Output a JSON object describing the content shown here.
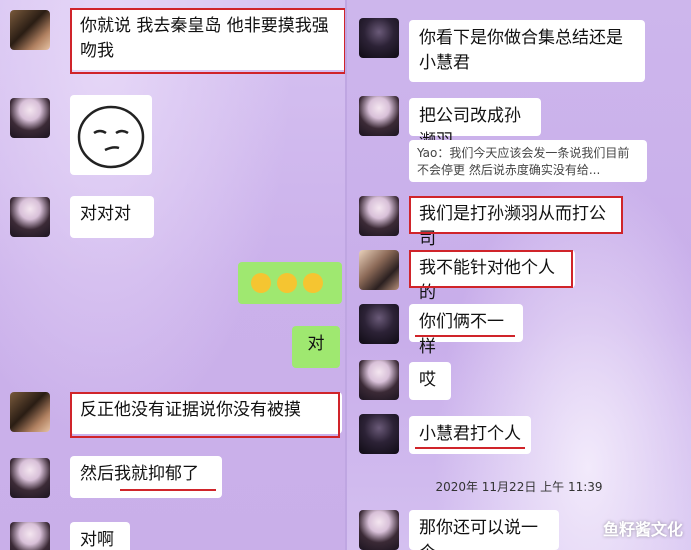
{
  "left": {
    "messages": [
      {
        "text": "你就说 我去秦皇岛 他非要摸我强吻我"
      },
      {
        "text": "对对对"
      },
      {
        "text": "对"
      },
      {
        "text": "反正他没有证据说你没有被摸"
      },
      {
        "text": "然后我就抑郁了"
      },
      {
        "text": "对啊"
      }
    ]
  },
  "right": {
    "messages": [
      {
        "text": "你看下是你做合集总结还是小慧君"
      },
      {
        "text": "把公司改成孙濒羽"
      },
      {
        "text": "Yao：我们今天应该会发一条说我们目前不会停更 然后说赤度确实没有给..."
      },
      {
        "text": "我们是打孙濒羽从而打公司"
      },
      {
        "text": "我不能针对他个人的"
      },
      {
        "text": "你们俩不一样"
      },
      {
        "text": "哎"
      },
      {
        "text": "小慧君打个人"
      },
      {
        "text": "那你还可以说一个"
      }
    ],
    "timestamp": "2020年 11月22日 上午 11:39"
  },
  "watermark": "鱼籽酱文化",
  "colors": {
    "highlight": "#d0242a",
    "sent_bubble": "#9fe870",
    "received_bubble": "#ffffff"
  }
}
